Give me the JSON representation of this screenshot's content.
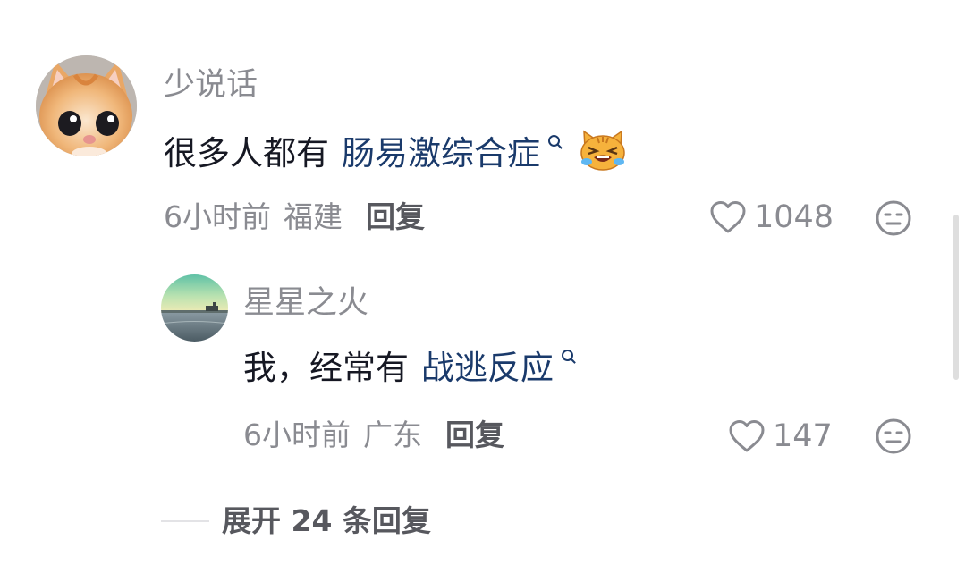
{
  "comment": {
    "username": "少说话",
    "text": "很多人都有",
    "link_text": "肠易激综合症",
    "emoji": "crying-cat-emoji",
    "time": "6小时前",
    "region": "福建",
    "reply_label": "回复",
    "likes": "1048",
    "heart_icon": "heart-outline-icon",
    "dislike_icon": "neutral-face-icon"
  },
  "reply": {
    "username": "星星之火",
    "text": "我，经常有",
    "link_text": "战逃反应",
    "time": "6小时前",
    "region": "广东",
    "reply_label": "回复",
    "likes": "147"
  },
  "expand": {
    "label": "展开 24 条回复"
  },
  "colors": {
    "username": "#8a8b91",
    "text": "#161823",
    "link": "#1a3a6b",
    "meta": "#8a8b91",
    "reply_button": "#57585e",
    "emoji_face": "#f6b23c"
  }
}
